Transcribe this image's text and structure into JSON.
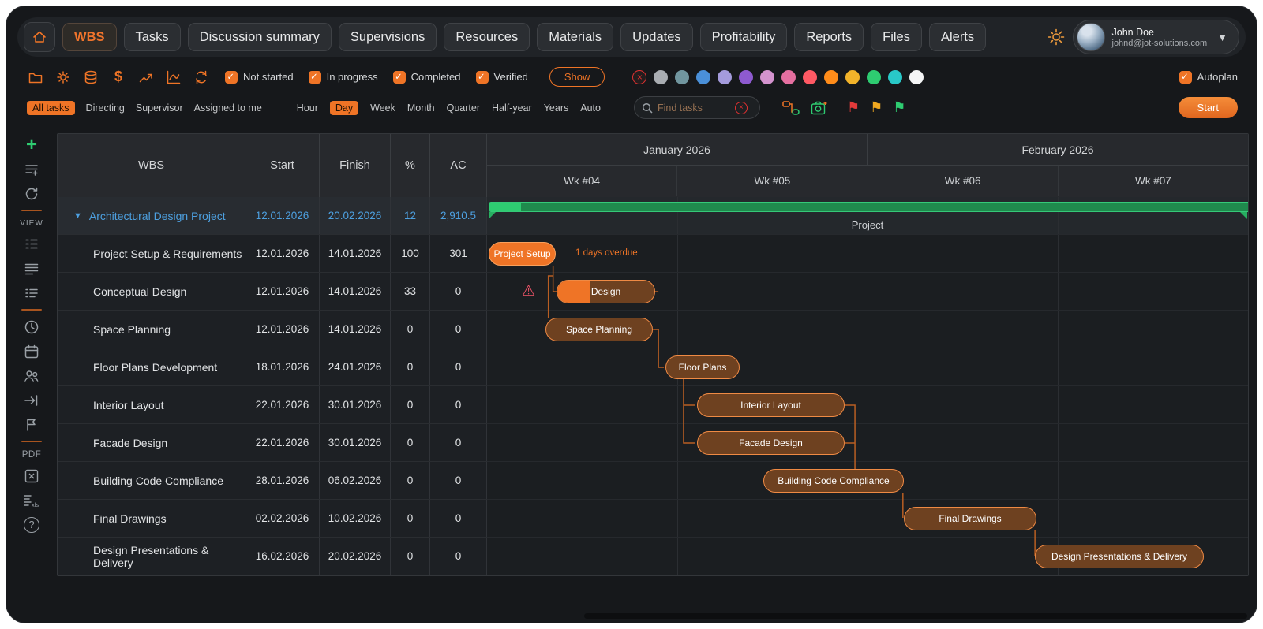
{
  "nav": {
    "tabs": [
      "WBS",
      "Tasks",
      "Discussion summary",
      "Supervisions",
      "Resources",
      "Materials",
      "Updates",
      "Profitability",
      "Reports",
      "Files",
      "Alerts"
    ],
    "active_tab": "WBS",
    "user": {
      "name": "John Doe",
      "email": "johnd@jot-solutions.com"
    }
  },
  "toolbar": {
    "status_filters": [
      {
        "label": "Not started",
        "checked": true
      },
      {
        "label": "In progress",
        "checked": true
      },
      {
        "label": "Completed",
        "checked": true
      },
      {
        "label": "Verified",
        "checked": true
      }
    ],
    "show_button": "Show",
    "palette": [
      "#a9adb2",
      "#71969f",
      "#4a90d9",
      "#a49bdc",
      "#8e5ad0",
      "#d493ce",
      "#e56fa0",
      "#ff5964",
      "#ff8c1a",
      "#f2b32a",
      "#2ecc71",
      "#29c8c8",
      "#f4f5f6"
    ],
    "autoplan_label": "Autoplan",
    "view_filters": [
      "All tasks",
      "Directing",
      "Supervisor",
      "Assigned to me"
    ],
    "active_view_filter": "All tasks",
    "timescales": [
      "Hour",
      "Day",
      "Week",
      "Month",
      "Quarter",
      "Half-year",
      "Years",
      "Auto"
    ],
    "active_timescale": "Day",
    "search_placeholder": "Find tasks",
    "start_button": "Start"
  },
  "sidebar": {
    "view_label": "VIEW",
    "pdf_label": "PDF"
  },
  "table": {
    "columns": [
      "WBS",
      "Start",
      "Finish",
      "%",
      "AC"
    ],
    "rows": [
      {
        "name": "Architectural Design Project",
        "start": "12.01.2026",
        "finish": "20.02.2026",
        "percent": "12",
        "ac": "2,910.5"
      },
      {
        "name": "Project Setup & Requirements",
        "start": "12.01.2026",
        "finish": "14.01.2026",
        "percent": "100",
        "ac": "301"
      },
      {
        "name": "Conceptual Design",
        "start": "12.01.2026",
        "finish": "14.01.2026",
        "percent": "33",
        "ac": "0"
      },
      {
        "name": "Space Planning",
        "start": "12.01.2026",
        "finish": "14.01.2026",
        "percent": "0",
        "ac": "0"
      },
      {
        "name": "Floor Plans Development",
        "start": "18.01.2026",
        "finish": "24.01.2026",
        "percent": "0",
        "ac": "0"
      },
      {
        "name": "Interior Layout",
        "start": "22.01.2026",
        "finish": "30.01.2026",
        "percent": "0",
        "ac": "0"
      },
      {
        "name": "Facade Design",
        "start": "22.01.2026",
        "finish": "30.01.2026",
        "percent": "0",
        "ac": "0"
      },
      {
        "name": "Building Code Compliance",
        "start": "28.01.2026",
        "finish": "06.02.2026",
        "percent": "0",
        "ac": "0"
      },
      {
        "name": "Final Drawings",
        "start": "02.02.2026",
        "finish": "10.02.2026",
        "percent": "0",
        "ac": "0"
      },
      {
        "name": "Design Presentations & Delivery",
        "start": "16.02.2026",
        "finish": "20.02.2026",
        "percent": "0",
        "ac": "0"
      }
    ]
  },
  "gantt": {
    "months": [
      "January 2026",
      "February 2026"
    ],
    "weeks": [
      "Wk #04",
      "Wk #05",
      "Wk #06",
      "Wk #07"
    ],
    "project_bar_label": "Project",
    "overdue_note": "1 days overdue",
    "bars": [
      {
        "label": "Project Setup",
        "progress": 100
      },
      {
        "label": "Design",
        "progress": 33
      },
      {
        "label": "Space Planning",
        "progress": 0
      },
      {
        "label": "Floor Plans",
        "progress": 0
      },
      {
        "label": "Interior Layout",
        "progress": 0
      },
      {
        "label": "Facade Design",
        "progress": 0
      },
      {
        "label": "Building Code Compliance",
        "progress": 0
      },
      {
        "label": "Final Drawings",
        "progress": 0
      },
      {
        "label": "Design Presentations & Delivery",
        "progress": 0
      }
    ]
  },
  "colors": {
    "accent": "#ef7426",
    "project_green": "#2ecc71",
    "link_blue": "#4da0e0",
    "warning_red": "#f4556a"
  }
}
